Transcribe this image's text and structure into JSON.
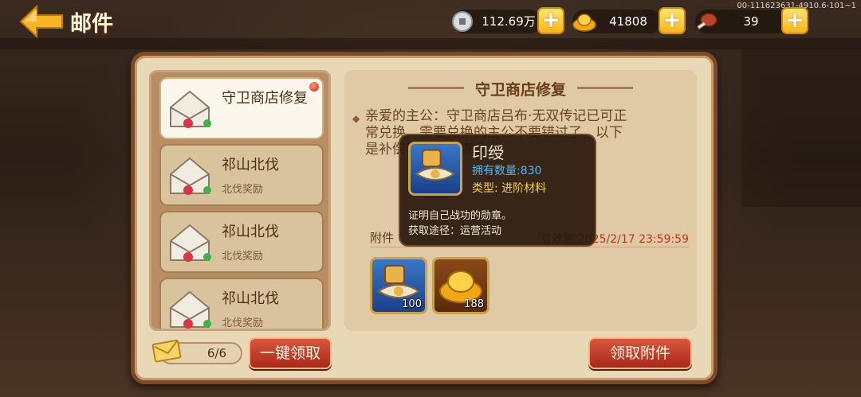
{
  "build_id": "00-111623631-4910.6-101~1",
  "header": {
    "title": "邮件"
  },
  "currencies": [
    {
      "icon": "silver-coin-icon",
      "value": "112.69万"
    },
    {
      "icon": "gold-ingot-icon",
      "value": "41808"
    },
    {
      "icon": "meat-drumstick-icon",
      "value": "39"
    }
  ],
  "plus_label": "+",
  "mail_list": [
    {
      "title": "守卫商店修复",
      "subtitle": "",
      "selected": true,
      "unread": true
    },
    {
      "title": "祁山北伐",
      "subtitle": "北伐奖励",
      "selected": false,
      "unread": false
    },
    {
      "title": "祁山北伐",
      "subtitle": "北伐奖励",
      "selected": false,
      "unread": false
    },
    {
      "title": "祁山北伐",
      "subtitle": "北伐奖励",
      "selected": false,
      "unread": false
    }
  ],
  "detail": {
    "title": "守卫商店修复",
    "body_line1": "亲爱的主公：守卫商店吕布·无双传记已可正",
    "body_line2": "常兑换，需要兑换的主公不要错过了。以下",
    "body_line3": "是补偿奖励，请查收。",
    "attachment_label": "附件",
    "expire_text": "有效期:2025/2/17 23:59:59",
    "attachments": [
      {
        "icon": "seal-ribbon-icon",
        "count": "100"
      },
      {
        "icon": "gold-ingot-icon",
        "count": "188"
      }
    ]
  },
  "tooltip": {
    "name": "印绶",
    "owned": "拥有数量:830",
    "type": "类型: 进阶材料",
    "desc1": "证明自己战功的勋章。",
    "desc2": "获取途径：运营活动"
  },
  "footer": {
    "mail_count": "6/6",
    "claim_all_label": "一键领取",
    "claim_attach_label": "领取附件"
  },
  "colors": {
    "panel_bg": "#e9d8b5",
    "frame": "#7a4a2a",
    "button_red": "#c23c26",
    "expire_red": "#c6341c"
  }
}
